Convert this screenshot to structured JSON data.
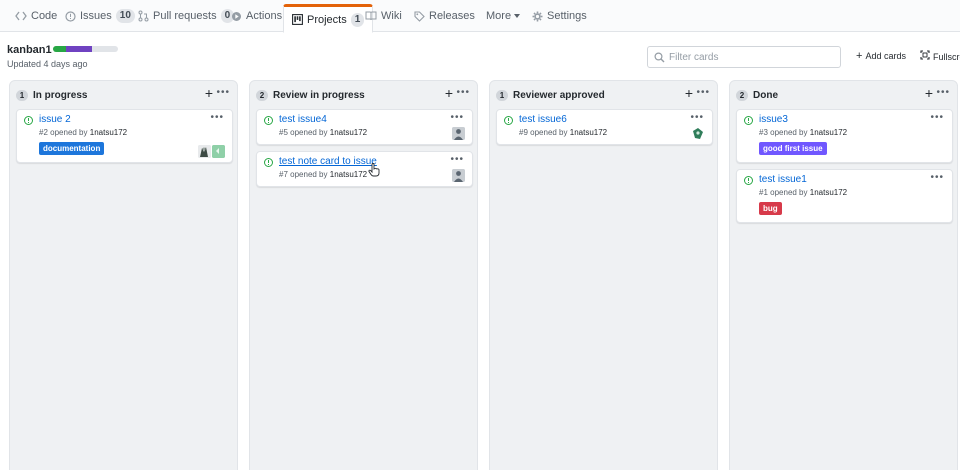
{
  "nav": {
    "code": "Code",
    "issues": "Issues",
    "issues_count": "10",
    "pulls": "Pull requests",
    "pulls_count": "0",
    "actions": "Actions",
    "projects": "Projects",
    "projects_count": "1",
    "wiki": "Wiki",
    "releases": "Releases",
    "more": "More",
    "settings": "Settings"
  },
  "project": {
    "name": "kanban1",
    "updated": "Updated 4 days ago",
    "progress": {
      "done_fraction": 0.2,
      "in_progress_fraction": 0.4
    }
  },
  "toolbar": {
    "filter_placeholder": "Filter cards",
    "add_cards": "Add cards",
    "fullscreen": "Fullscre"
  },
  "columns": [
    {
      "count": "1",
      "title": "In progress",
      "cards": [
        {
          "title": "issue 2",
          "number": "#2",
          "opened_by": "opened by",
          "author": "1natsu172",
          "label": "documentation",
          "label_color": "#1d76db"
        }
      ]
    },
    {
      "count": "2",
      "title": "Review in progress",
      "cards": [
        {
          "title": "test issue4",
          "number": "#5",
          "opened_by": "opened by",
          "author": "1natsu172"
        },
        {
          "title": "test note card to issue",
          "number": "#7",
          "opened_by": "opened by",
          "author": "1natsu172"
        }
      ]
    },
    {
      "count": "1",
      "title": "Reviewer approved",
      "cards": [
        {
          "title": "test issue6",
          "number": "#9",
          "opened_by": "opened by",
          "author": "1natsu172"
        }
      ]
    },
    {
      "count": "2",
      "title": "Done",
      "cards": [
        {
          "title": "issue3",
          "number": "#3",
          "opened_by": "opened by",
          "author": "1natsu172",
          "label": "good first issue",
          "label_color": "#7057ff"
        },
        {
          "title": "test issue1",
          "number": "#1",
          "opened_by": "opened by",
          "author": "1natsu172",
          "label": "bug",
          "label_color": "#d73a4a"
        }
      ]
    }
  ],
  "colors": {
    "accent": "#e36209",
    "link": "#0366d6",
    "open_issue": "#28a745",
    "progress_done": "#28a745",
    "progress_in_progress": "#6f42c1"
  },
  "icons": {
    "code": "code-icon",
    "issues": "issue-opened-icon",
    "pulls": "git-pull-request-icon",
    "actions": "play-icon",
    "projects": "project-icon",
    "wiki": "book-icon",
    "releases": "tag-icon",
    "settings": "gear-icon",
    "filter": "search-icon",
    "add": "plus-icon",
    "fullscreen": "screen-full-icon",
    "menu": "kebab-horizontal-icon"
  }
}
